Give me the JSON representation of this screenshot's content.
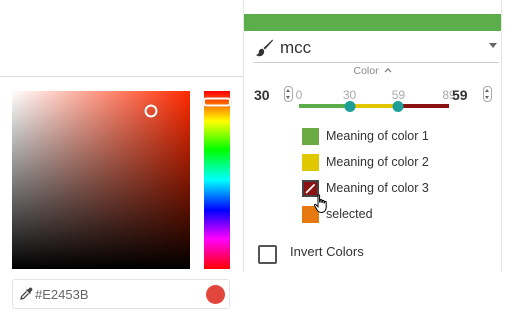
{
  "colors": {
    "hue": "#ff2a00",
    "accent_green": "#5cae4a",
    "thumb": "#1e9e98",
    "selected_hex": "#E2453B"
  },
  "picker": {
    "hex_value": "#E2453B",
    "eyedropper_icon": "eyedropper-icon",
    "hue_position": 0.06,
    "saturation": 0.78,
    "brightness": 0.89
  },
  "panel": {
    "field_name": "mcc",
    "field_icon": "paintbrush-icon",
    "color_toggle": "Color",
    "range": {
      "min_value": "30",
      "max_value": "59",
      "domain_min": 0,
      "domain_max": 89,
      "ticks": [
        "0",
        "30",
        "59",
        "89"
      ],
      "track_colors": [
        "#5cae4a",
        "#e1c600",
        "#8b1010"
      ]
    },
    "legend": [
      {
        "label": "Meaning of color 1",
        "color": "#6aab45"
      },
      {
        "label": "Meaning of color 2",
        "color": "#e0c800"
      },
      {
        "label": "Meaning of color 3",
        "color": "#8b1212",
        "editing": true
      },
      {
        "label": "selected",
        "color": "#e67a10"
      }
    ],
    "invert_label": "Invert Colors",
    "invert_checked": false
  }
}
